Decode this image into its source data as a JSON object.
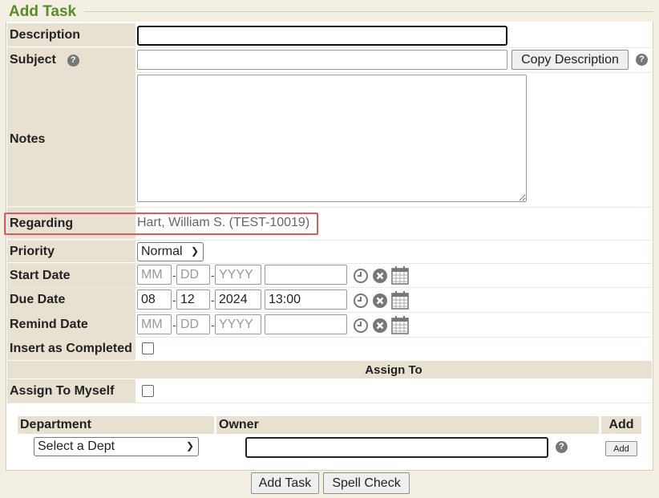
{
  "form": {
    "title": "Add Task",
    "description_label": "Description",
    "description_value": "",
    "subject_label": "Subject",
    "subject_value": "",
    "copy_description_label": "Copy Description",
    "notes_label": "Notes",
    "notes_value": "",
    "regarding_label": "Regarding",
    "regarding_value": "Hart, William S. (TEST-10019)",
    "priority_label": "Priority",
    "priority_value": "Normal",
    "start_date": {
      "label": "Start Date",
      "mm": "",
      "dd": "",
      "yyyy": "",
      "time": "",
      "mm_placeholder": "MM",
      "dd_placeholder": "DD",
      "yyyy_placeholder": "YYYY"
    },
    "due_date": {
      "label": "Due Date",
      "mm": "08",
      "dd": "12",
      "yyyy": "2024",
      "time": "13:00",
      "mm_placeholder": "MM",
      "dd_placeholder": "DD",
      "yyyy_placeholder": "YYYY"
    },
    "remind_date": {
      "label": "Remind Date",
      "mm": "",
      "dd": "",
      "yyyy": "",
      "time": "",
      "mm_placeholder": "MM",
      "dd_placeholder": "DD",
      "yyyy_placeholder": "YYYY"
    },
    "insert_completed_label": "Insert as Completed",
    "assign_to_header": "Assign To",
    "assign_myself_label": "Assign To Myself",
    "department_header": "Department",
    "owner_header": "Owner",
    "add_header": "Add",
    "department_select": "Select a Dept",
    "owner_value": "",
    "add_button": "Add"
  },
  "footer": {
    "add_task_button": "Add Task",
    "spell_check_button": "Spell Check"
  },
  "icons": {
    "help": "help-icon",
    "clock": "clock-icon",
    "clear": "clear-icon",
    "calendar": "calendar-icon"
  },
  "colors": {
    "title": "#5b8a2a",
    "label_bg": "#e8e1d2",
    "highlight": "#e05a5a"
  }
}
